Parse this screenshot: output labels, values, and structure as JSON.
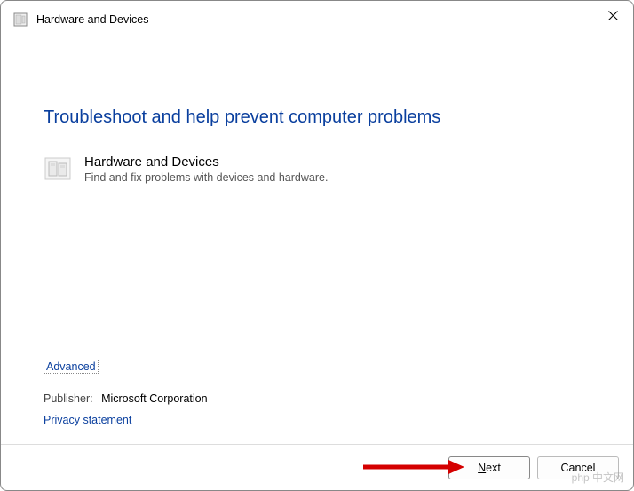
{
  "titlebar": {
    "title": "Hardware and Devices"
  },
  "main": {
    "heading": "Troubleshoot and help prevent computer problems",
    "troubleshooter": {
      "title": "Hardware and Devices",
      "description": "Find and fix problems with devices and hardware."
    }
  },
  "links": {
    "advanced": "Advanced",
    "privacy": "Privacy statement"
  },
  "publisher": {
    "label": "Publisher:",
    "name": "Microsoft Corporation"
  },
  "footer": {
    "next": "Next",
    "cancel": "Cancel"
  },
  "watermark": "php 中文网"
}
